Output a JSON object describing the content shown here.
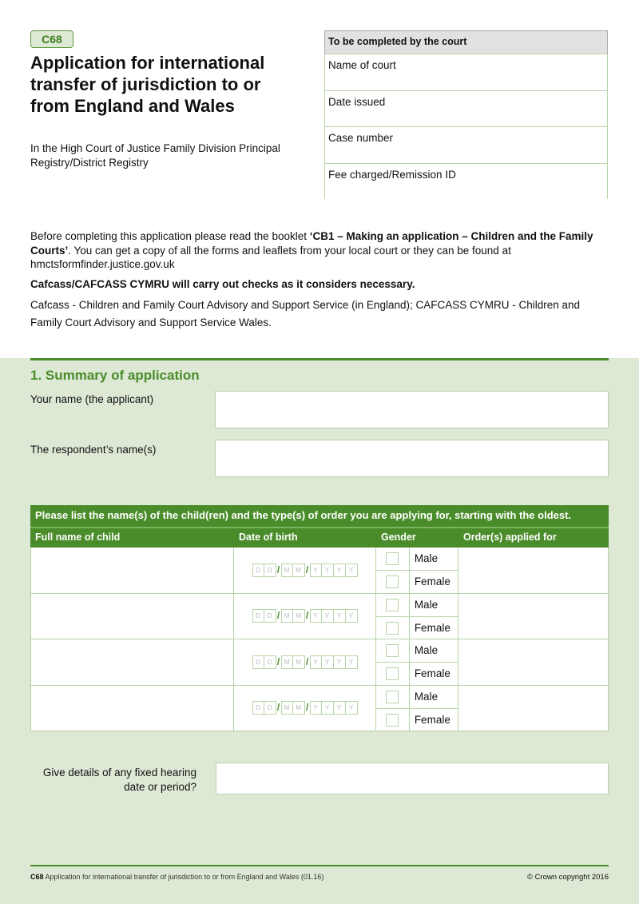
{
  "header": {
    "form_code": "C68",
    "title": "Application for international transfer of jurisdiction to or from England and Wales",
    "subtitle": "In the High Court of Justice Family Division Principal Registry/District Registry"
  },
  "court_box": {
    "heading": "To be completed by the court",
    "rows": [
      "Name of court",
      "Date issued",
      "Case number",
      "Fee charged/Remission ID"
    ]
  },
  "intro": {
    "p1_pre": "Before completing this application please read the booklet ",
    "p1_bold": "‘CB1 – Making an application – Children and the Family Courts’",
    "p1_post": ". You can get a copy of all the forms and leaflets from your local court or they can be found at hmctsformfinder.justice.gov.uk",
    "p2": "Cafcass/CAFCASS CYMRU will carry out checks as it considers necessary.",
    "p3": "Cafcass - Children and Family Court Advisory and Support Service (in England); CAFCASS CYMRU - Children and Family Court Advisory and Support Service Wales."
  },
  "section1": {
    "title": "1. Summary of application",
    "applicant_label": "Your name (the applicant)",
    "applicant_value": "",
    "respondent_label": "The respondent’s name(s)",
    "respondent_value": "",
    "children_table": {
      "heading": "Please list the name(s) of the child(ren) and the type(s) of order you are applying for, starting with the oldest.",
      "columns": [
        "Full name of child",
        "Date of birth",
        "Gender",
        "Order(s) applied for"
      ],
      "dob_placeholders": [
        "D",
        "D",
        "M",
        "M",
        "Y",
        "Y",
        "Y",
        "Y"
      ],
      "gender_options": [
        "Male",
        "Female"
      ],
      "rows": [
        {
          "name": "",
          "order": ""
        },
        {
          "name": "",
          "order": ""
        },
        {
          "name": "",
          "order": ""
        },
        {
          "name": "",
          "order": ""
        }
      ]
    },
    "hearing_label": "Give details of any fixed hearing date or period?",
    "hearing_value": ""
  },
  "footer": {
    "code": "C68",
    "text": " Application for international transfer of jurisdiction to or from England and Wales (01.16)",
    "copyright": "© Crown copyright 2016"
  },
  "colors": {
    "accent": "#4a8c2a",
    "section_bg": "#dde8d5",
    "border": "#b7d3a8"
  }
}
